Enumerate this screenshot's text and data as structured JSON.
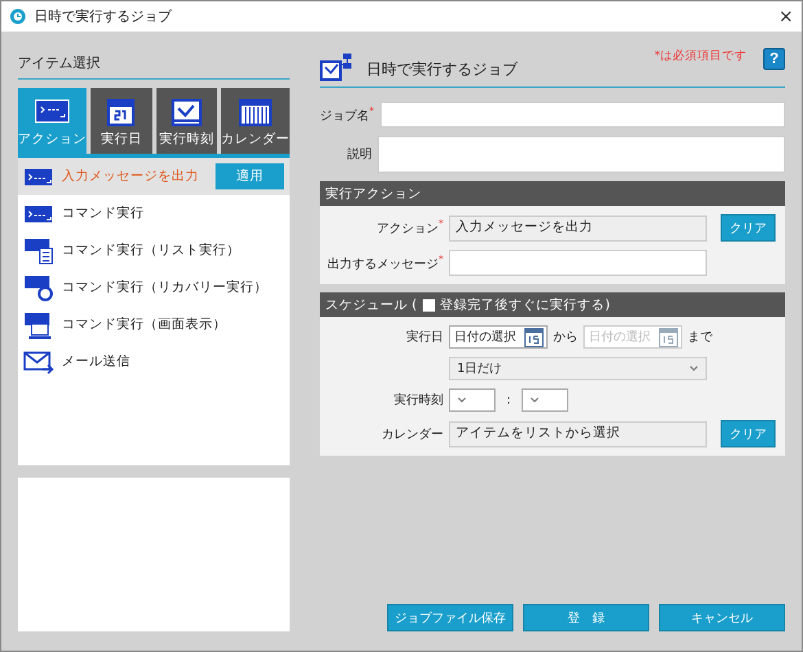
{
  "window": {
    "title": "日時で実行するジョブ",
    "close": "×"
  },
  "left": {
    "heading": "アイテム選択",
    "tabs": [
      {
        "label": "アクション",
        "kind": "action",
        "selected": true
      },
      {
        "label": "実行日",
        "kind": "date",
        "selected": false
      },
      {
        "label": "実行時刻",
        "kind": "time",
        "selected": false
      },
      {
        "label": "カレンダー",
        "kind": "calendar",
        "selected": false
      }
    ],
    "items": [
      {
        "label": "入力メッセージを出力",
        "kind": "console",
        "selected": true,
        "button": "適用"
      },
      {
        "label": "コマンド実行",
        "kind": "console",
        "selected": false
      },
      {
        "label": "コマンド実行（リスト実行）",
        "kind": "list",
        "selected": false
      },
      {
        "label": "コマンド実行（リカバリー実行）",
        "kind": "recovery",
        "selected": false
      },
      {
        "label": "コマンド実行（画面表示）",
        "kind": "screen",
        "selected": false
      },
      {
        "label": "メール送信",
        "kind": "mail",
        "selected": false
      }
    ]
  },
  "form": {
    "title": "日時で実行するジョブ",
    "required_note": "*は必須項目です",
    "help": "?",
    "job_name": {
      "label": "ジョブ名",
      "mark": "*"
    },
    "description": {
      "label": "説明"
    },
    "action_section": {
      "title": "実行アクション",
      "action": {
        "label": "アクション",
        "mark": "*",
        "value": "入力メッセージを出力",
        "button": "クリア"
      },
      "message": {
        "label": "出力するメッセージ",
        "mark": "*"
      }
    },
    "schedule": {
      "title": "スケジュール (",
      "checkbox": {
        "label": "登録完了後すぐに実行する)",
        "checked": false
      },
      "date": {
        "label": "実行日",
        "from_placeholder": "日付の選択",
        "from_word": "から",
        "to_placeholder": "日付の選択",
        "to_word": "まで"
      },
      "repeat": {
        "value": "1日だけ"
      },
      "time": {
        "label": "実行時刻",
        "separator": ":"
      },
      "calendar": {
        "label": "カレンダー",
        "value": "アイテムをリストから選択",
        "button": "クリア"
      }
    }
  },
  "buttons": [
    "ジョブファイル保存",
    "登　録",
    "キャンセル"
  ]
}
